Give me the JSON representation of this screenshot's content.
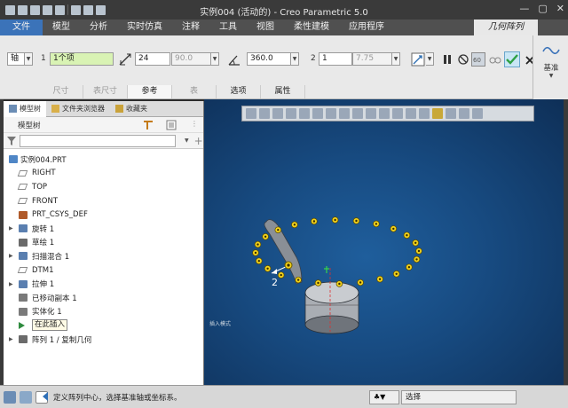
{
  "window": {
    "title": "实例004 (活动的) - Creo Parametric 5.0",
    "minimize": "—",
    "maximize": "▢",
    "close": "✕"
  },
  "menu": {
    "file": "文件",
    "tabs": [
      "模型",
      "分析",
      "实时仿真",
      "注释",
      "工具",
      "视图",
      "柔性建模",
      "应用程序"
    ],
    "active_tab": "几何阵列"
  },
  "ribbon": {
    "type_value": "轴",
    "num1_label": "1",
    "ref_value": "1个项",
    "count_value": "24",
    "angle_value": "90.0",
    "total_angle": "360.0",
    "num2_label": "2",
    "second_count": "1",
    "second_value": "7.75",
    "right_label": "基准"
  },
  "subtabs": [
    "尺寸",
    "表尺寸",
    "参考",
    "表",
    "选项",
    "属性"
  ],
  "left_panel": {
    "tabs": [
      "模型树",
      "文件夹浏览器",
      "收藏夹"
    ],
    "header": "模型树",
    "tree": [
      {
        "label": "实例004.PRT",
        "toggle": "",
        "icon": "part",
        "root": true
      },
      {
        "label": "RIGHT",
        "toggle": "",
        "icon": "plane"
      },
      {
        "label": "TOP",
        "toggle": "",
        "icon": "plane"
      },
      {
        "label": "FRONT",
        "toggle": "",
        "icon": "plane"
      },
      {
        "label": "PRT_CSYS_DEF",
        "toggle": "",
        "icon": "csys"
      },
      {
        "label": "旋转 1",
        "toggle": "▶",
        "icon": "revolve"
      },
      {
        "label": "草绘 1",
        "toggle": "",
        "icon": "sketch"
      },
      {
        "label": "扫描混合 1",
        "toggle": "▶",
        "icon": "sweep"
      },
      {
        "label": "DTM1",
        "toggle": "",
        "icon": "plane"
      },
      {
        "label": "拉伸 1",
        "toggle": "▶",
        "icon": "extrude"
      },
      {
        "label": "已移动副本 1",
        "toggle": "",
        "icon": "move"
      },
      {
        "label": "实体化 1",
        "toggle": "",
        "icon": "solidify"
      },
      {
        "label": "在此插入",
        "toggle": "",
        "icon": "insert",
        "boxed": true
      },
      {
        "label": "阵列 1 / 复制几何",
        "toggle": "▶",
        "icon": "pattern"
      }
    ]
  },
  "viewport": {
    "side_label": "插入模式",
    "dimension_label": "2",
    "pattern_points": 24
  },
  "status": {
    "message": "定义阵列中心，选择基准轴或坐标系。",
    "filter": "选择"
  },
  "colors": {
    "file_tab": "#3b73b9",
    "viewport_bg": "#174a80",
    "pattern_dot": "#f2d21c",
    "accept_green": "#2ea043"
  }
}
